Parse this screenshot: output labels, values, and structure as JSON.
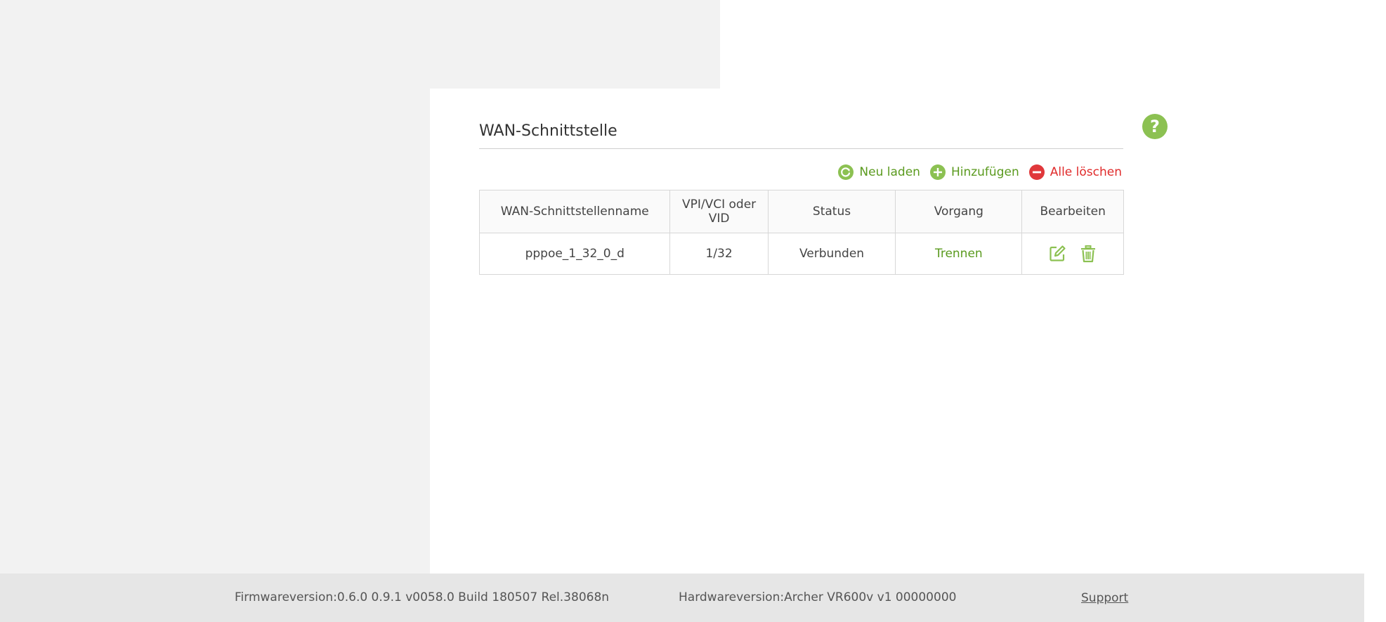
{
  "page": {
    "title": "WAN-Schnittstelle",
    "help_symbol": "?"
  },
  "toolbar": {
    "reload_label": "Neu laden",
    "add_label": "Hinzufügen",
    "delete_all_label": "Alle löschen"
  },
  "table": {
    "headers": {
      "name": "WAN-Schnittstellenname",
      "vpi_vci": "VPI/VCI oder VID",
      "status": "Status",
      "action": "Vorgang",
      "edit": "Bearbeiten"
    },
    "rows": [
      {
        "name": "pppoe_1_32_0_d",
        "vpi_vci": "1/32",
        "status": "Verbunden",
        "action": "Trennen"
      }
    ]
  },
  "footer": {
    "firmware": "Firmwareversion:0.6.0 0.9.1 v0058.0 Build 180507 Rel.38068n",
    "hardware": "Hardwareversion:Archer VR600v v1 00000000",
    "support": "Support"
  },
  "colors": {
    "accent_green": "#8cc152",
    "link_green": "#5a9a1e",
    "danger_red": "#e0383b",
    "sidebar_gray": "#f2f2f2",
    "footer_gray": "#e6e6e6"
  },
  "icons": {
    "help": "help-icon",
    "reload": "refresh-icon",
    "add": "plus-icon",
    "delete_all": "minus-icon",
    "edit": "edit-icon",
    "delete": "trash-icon"
  }
}
